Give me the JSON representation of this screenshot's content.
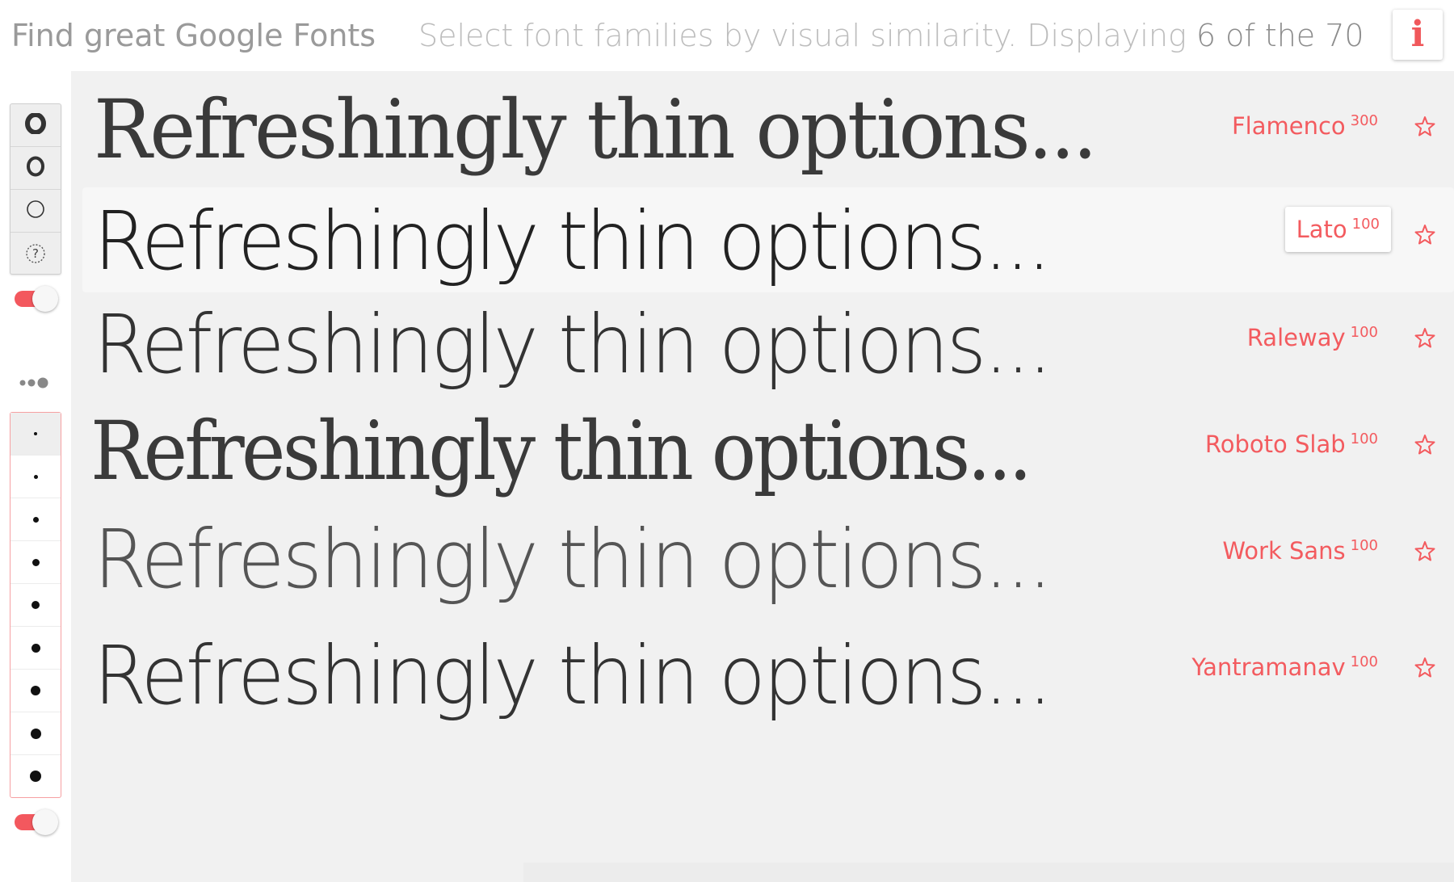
{
  "header": {
    "title": "Find great Google Fonts",
    "subtitle_prefix": "Select font families by visual similarity.  Displaying",
    "count_text": "6 of the 70",
    "info_label": "i"
  },
  "sidebar": {
    "weight_buttons": [
      {
        "name": "weight-bold-icon",
        "label": "bold"
      },
      {
        "name": "weight-regular-icon",
        "label": "regular"
      },
      {
        "name": "weight-thin-icon",
        "label": "thin"
      },
      {
        "name": "weight-any-icon",
        "label": "?"
      }
    ],
    "weight_question_glyph": "?",
    "toggle_top_on": true,
    "toggle_bottom_on": true,
    "size_buttons": [
      {
        "selected": true
      },
      {
        "selected": false
      },
      {
        "selected": false
      },
      {
        "selected": false
      },
      {
        "selected": false
      },
      {
        "selected": false
      },
      {
        "selected": false
      },
      {
        "selected": false
      },
      {
        "selected": false
      }
    ]
  },
  "sample_text": "Refreshingly thin options...",
  "fonts": [
    {
      "family": "Flamenco",
      "weight": "300",
      "hovered": false
    },
    {
      "family": "Lato",
      "weight": "100",
      "hovered": true
    },
    {
      "family": "Raleway",
      "weight": "100",
      "hovered": false
    },
    {
      "family": "Roboto Slab",
      "weight": "100",
      "hovered": false
    },
    {
      "family": "Work Sans",
      "weight": "100",
      "hovered": false
    },
    {
      "family": "Yantramanav",
      "weight": "100",
      "hovered": false
    }
  ],
  "colors": {
    "accent": "#f35b5f",
    "sample_text": "#333333",
    "main_bg": "#f1f1f1"
  }
}
